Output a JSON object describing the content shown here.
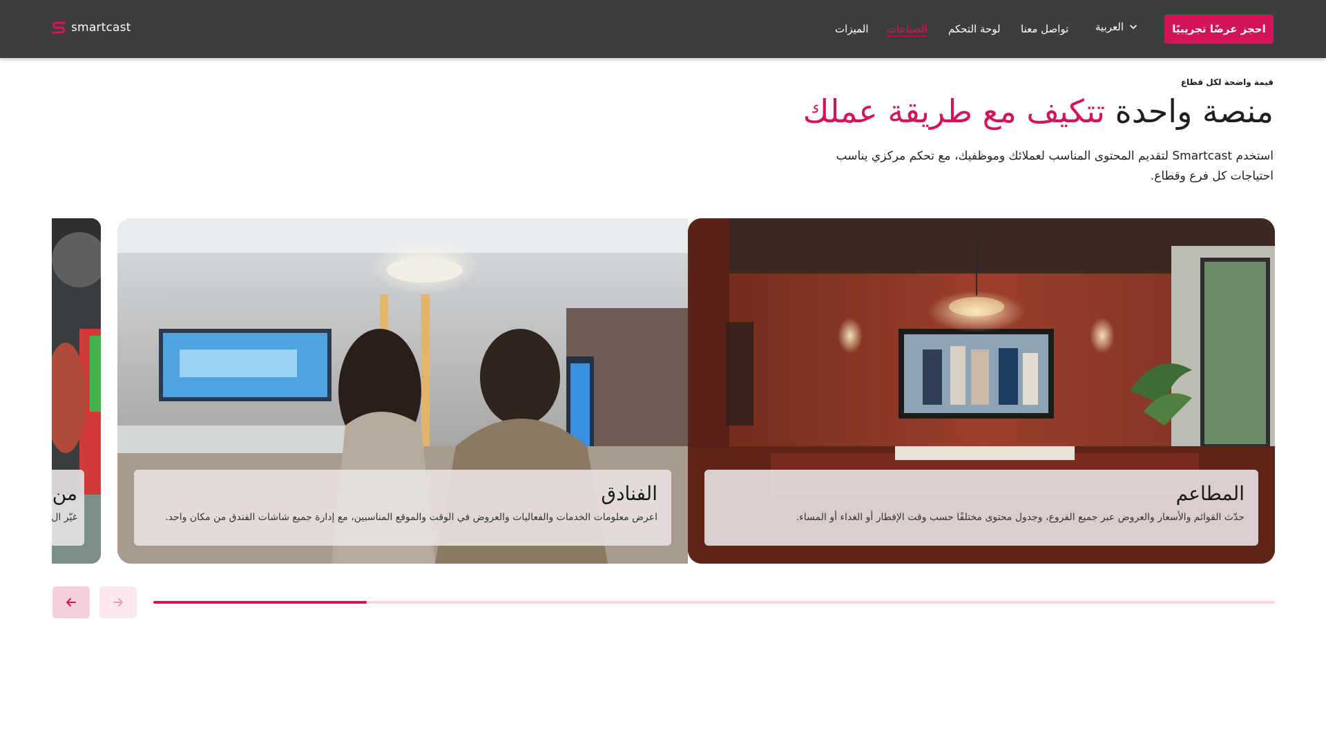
{
  "brand": {
    "name": "smartcast",
    "accent_color": "#d4145a",
    "header_bg": "#3d3d3d"
  },
  "nav": {
    "items": [
      {
        "label": "الميزات",
        "active": false
      },
      {
        "label": "الصناعات",
        "active": true
      },
      {
        "label": "لوحة التحكم",
        "active": false
      },
      {
        "label": "تواصل معنا",
        "active": false
      }
    ],
    "language": {
      "label": "العربية",
      "icon": "chevron-down-icon"
    },
    "cta_label": "احجز عرضًا تجريبيًا"
  },
  "hero": {
    "eyebrow": "قيمة واضحة لكل قطاع",
    "headline_plain": "منصة واحدة",
    "headline_accent": "تتكيف مع طريقة عملك",
    "subtext": "استخدم Smartcast لتقديم المحتوى المناسب لعملائك وموظفيك، مع تحكم مركزي يناسب احتياجات كل فرع وقطاع."
  },
  "carousel": {
    "cards": [
      {
        "title": "المطاعم",
        "description": "حدّث القوائم والأسعار والعروض عبر جميع الفروع، وجدول محتوى مختلفًا حسب وقت الإفطار أو الغداء أو المساء.",
        "image": "restaurant-photo"
      },
      {
        "title": "الفنادق",
        "description": "اعرض معلومات الخدمات والفعاليات والعروض في الوقت والموقع المناسبين، مع إدارة جميع شاشات الفندق من مكان واحد.",
        "image": "hotel-photo"
      },
      {
        "title": "من",
        "description": "غيّر ال",
        "image": "partial-photo"
      }
    ],
    "prev_icon": "arrow-left-icon",
    "next_icon": "arrow-right-icon",
    "progress": 0.19
  }
}
